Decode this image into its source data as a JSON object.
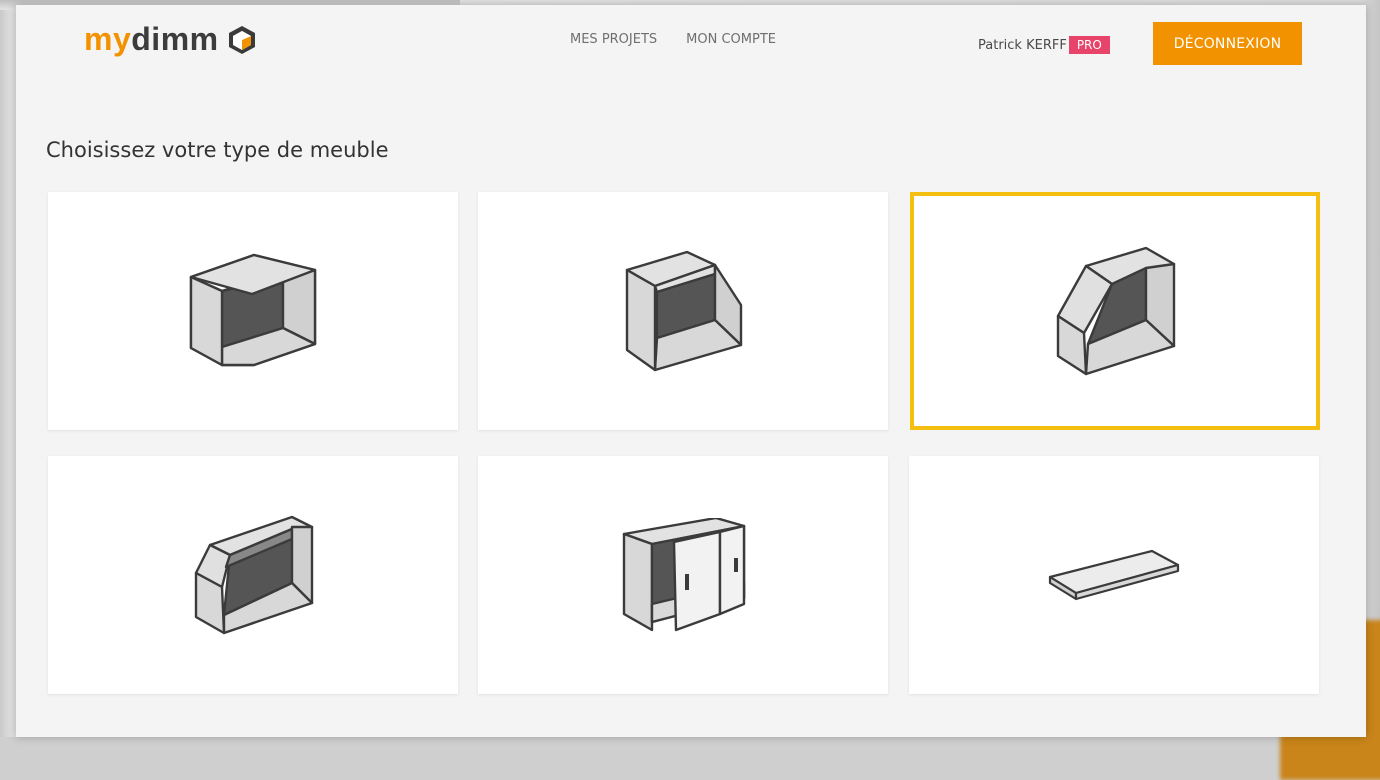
{
  "brand": {
    "part1": "my",
    "part2": "dimm",
    "accent": "#f39200"
  },
  "nav": {
    "projects": "MES PROJETS",
    "account": "MON COMPTE"
  },
  "user": {
    "name": "Patrick KERFF",
    "badge": "PRO",
    "badge_color": "#e8436b"
  },
  "logout_label": "DÉCONNEXION",
  "page_title": "Choisissez votre type de meuble",
  "selection_color": "#f5bf12",
  "furniture_types": [
    {
      "icon": "open-box-icon",
      "selected": false
    },
    {
      "icon": "box-cut-right-icon",
      "selected": false
    },
    {
      "icon": "box-cut-left-icon",
      "selected": true
    },
    {
      "icon": "box-sloped-top-icon",
      "selected": false
    },
    {
      "icon": "sliding-doors-cabinet-icon",
      "selected": false
    },
    {
      "icon": "shelf-board-icon",
      "selected": false
    }
  ]
}
